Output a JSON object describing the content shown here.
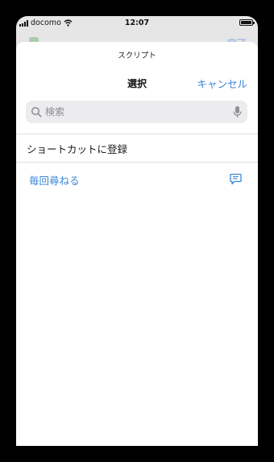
{
  "status_bar": {
    "carrier": "docomo",
    "time": "12:07"
  },
  "background_app": {
    "done_label": "完了"
  },
  "sheet": {
    "title": "スクリプト"
  },
  "nav": {
    "title": "選択",
    "cancel_label": "キャンセル"
  },
  "search": {
    "placeholder": "検索",
    "value": ""
  },
  "list": {
    "items": [
      {
        "label": "ショートカットに登録",
        "icon": ""
      },
      {
        "label": "毎回尋ねる",
        "icon": "comment-icon"
      }
    ]
  },
  "colors": {
    "accent": "#3A86D8",
    "background": "#FFFFFF",
    "search_bg": "#ECECEE"
  }
}
